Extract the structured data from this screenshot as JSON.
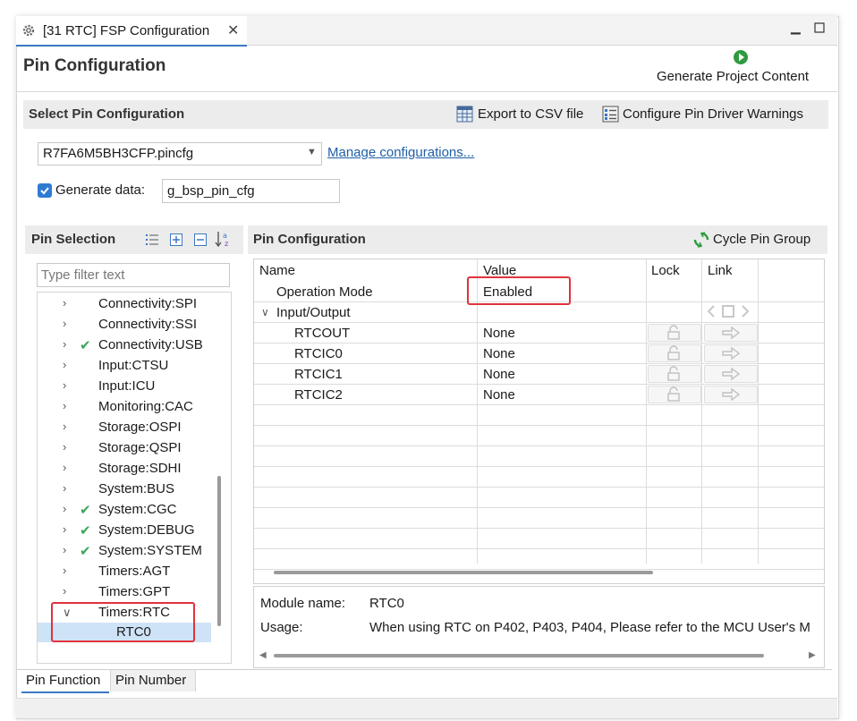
{
  "tab": {
    "title": "[31 RTC] FSP Configuration",
    "close": "✕"
  },
  "window_buttons": {
    "minimize": "▭",
    "maximize": "☐"
  },
  "header": {
    "title": "Pin Configuration",
    "generate_label": "Generate Project Content"
  },
  "select_pin": {
    "title": "Select Pin Configuration",
    "export_label": "Export to CSV file",
    "warnings_label": "Configure Pin Driver Warnings",
    "config_file": "R7FA6M5BH3CFP.pincfg",
    "manage_link": "Manage configurations...",
    "generate_data_label": "Generate data:",
    "generate_data_value": "g_bsp_pin_cfg",
    "generate_data_checked": true
  },
  "pin_selection": {
    "title": "Pin Selection",
    "filter_placeholder": "Type filter text",
    "items": [
      {
        "label": "Connectivity:SPI",
        "checked": false,
        "expanded": false
      },
      {
        "label": "Connectivity:SSI",
        "checked": false,
        "expanded": false
      },
      {
        "label": "Connectivity:USB",
        "checked": true,
        "expanded": false
      },
      {
        "label": "Input:CTSU",
        "checked": false,
        "expanded": false
      },
      {
        "label": "Input:ICU",
        "checked": false,
        "expanded": false
      },
      {
        "label": "Monitoring:CAC",
        "checked": false,
        "expanded": false
      },
      {
        "label": "Storage:OSPI",
        "checked": false,
        "expanded": false
      },
      {
        "label": "Storage:QSPI",
        "checked": false,
        "expanded": false
      },
      {
        "label": "Storage:SDHI",
        "checked": false,
        "expanded": false
      },
      {
        "label": "System:BUS",
        "checked": false,
        "expanded": false
      },
      {
        "label": "System:CGC",
        "checked": true,
        "expanded": false
      },
      {
        "label": "System:DEBUG",
        "checked": true,
        "expanded": false
      },
      {
        "label": "System:SYSTEM",
        "checked": true,
        "expanded": false
      },
      {
        "label": "Timers:AGT",
        "checked": false,
        "expanded": false
      },
      {
        "label": "Timers:GPT",
        "checked": false,
        "expanded": false
      },
      {
        "label": "Timers:RTC",
        "checked": false,
        "expanded": true
      }
    ],
    "child_selected": "RTC0"
  },
  "pin_config": {
    "title": "Pin Configuration",
    "cycle_label": "Cycle Pin Group",
    "columns": {
      "name": "Name",
      "value": "Value",
      "lock": "Lock",
      "link": "Link"
    },
    "rows": [
      {
        "name": "Operation Mode",
        "value": "Enabled"
      },
      {
        "name": "Input/Output",
        "value": ""
      },
      {
        "name": "RTCOUT",
        "value": "None"
      },
      {
        "name": "RTCIC0",
        "value": "None"
      },
      {
        "name": "RTCIC1",
        "value": "None"
      },
      {
        "name": "RTCIC2",
        "value": "None"
      }
    ],
    "module_name_label": "Module name:",
    "module_name_value": "RTC0",
    "usage_label": "Usage:",
    "usage_value": "When using RTC on P402, P403, P404, Please refer to the MCU User's M"
  },
  "bottom_tabs": {
    "pin_function": "Pin Function",
    "pin_number": "Pin Number"
  },
  "colors": {
    "accent": "#3a78c2",
    "check_green": "#3aa55a",
    "highlight_red": "#e0323c",
    "selection_blue": "#cfe3f7"
  }
}
